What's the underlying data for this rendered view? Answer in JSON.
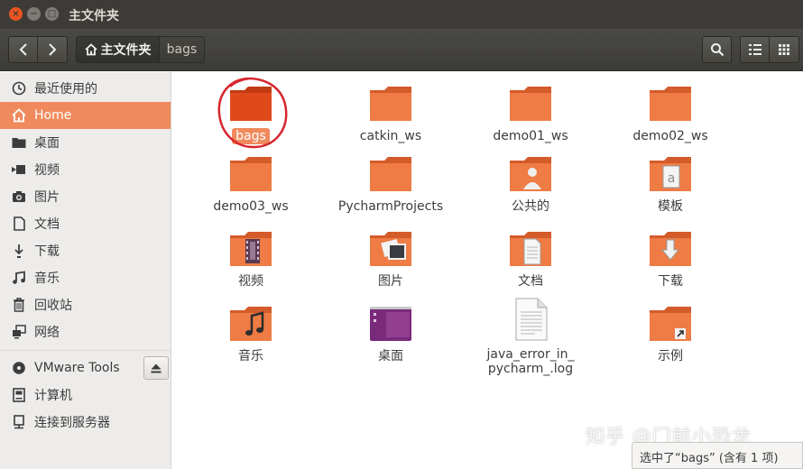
{
  "window": {
    "title": "主文件夹"
  },
  "toolbar": {
    "breadcrumb": [
      {
        "label": "主文件夹"
      },
      {
        "label": "bags"
      }
    ]
  },
  "sidebar": {
    "items": [
      {
        "label": "最近使用的",
        "icon": "clock-icon"
      },
      {
        "label": "Home",
        "icon": "home-icon",
        "active": true
      },
      {
        "label": "桌面",
        "icon": "folder-icon"
      },
      {
        "label": "视频",
        "icon": "video-icon"
      },
      {
        "label": "图片",
        "icon": "camera-icon"
      },
      {
        "label": "文档",
        "icon": "document-icon"
      },
      {
        "label": "下载",
        "icon": "download-icon"
      },
      {
        "label": "音乐",
        "icon": "music-icon"
      },
      {
        "label": "回收站",
        "icon": "trash-icon"
      },
      {
        "label": "网络",
        "icon": "network-icon"
      },
      {
        "label": "VMware Tools",
        "icon": "disk-icon"
      },
      {
        "label": "计算机",
        "icon": "computer-icon"
      },
      {
        "label": "连接到服务器",
        "icon": "server-icon"
      }
    ]
  },
  "files": [
    {
      "name": "bags",
      "type": "folder",
      "selected": true
    },
    {
      "name": "catkin_ws",
      "type": "folder"
    },
    {
      "name": "demo01_ws",
      "type": "folder"
    },
    {
      "name": "demo02_ws",
      "type": "folder"
    },
    {
      "name": "demo03_ws",
      "type": "folder"
    },
    {
      "name": "PycharmProjects",
      "type": "folder"
    },
    {
      "name": "公共的",
      "type": "folder-public"
    },
    {
      "name": "模板",
      "type": "folder-templates"
    },
    {
      "name": "视频",
      "type": "folder-videos"
    },
    {
      "name": "图片",
      "type": "folder-pictures"
    },
    {
      "name": "文档",
      "type": "folder-documents"
    },
    {
      "name": "下载",
      "type": "folder-downloads"
    },
    {
      "name": "音乐",
      "type": "folder-music"
    },
    {
      "name": "桌面",
      "type": "folder-desktop"
    },
    {
      "name": "java_error_in_pycharm_.log",
      "type": "text-file",
      "name_line1": "java_error_in_",
      "name_line2": "pycharm_.log"
    },
    {
      "name": "示例",
      "type": "folder-link"
    }
  ],
  "status": {
    "text": "选中了“bags” (含有 1 项)"
  },
  "watermark": {
    "text": "知乎 @门前小恐龙"
  },
  "colors": {
    "accent": "#f08a5d",
    "folder": "#e8743a",
    "titlebar": "#3c3b37"
  }
}
